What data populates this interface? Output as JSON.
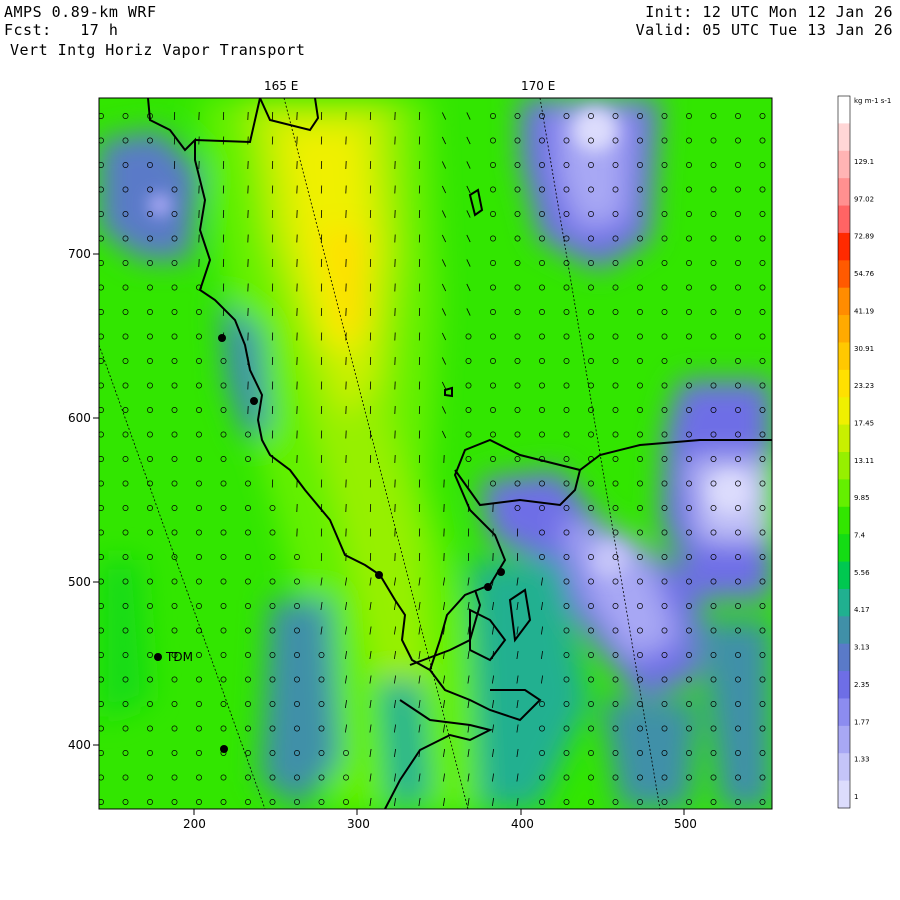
{
  "header": {
    "model": "AMPS 0.89-km WRF",
    "forecast": "Fcst:   17 h",
    "field": "Vert Intg Horiz Vapor Transport",
    "init": "Init: 12 UTC Mon 12 Jan 26",
    "valid": "Valid: 05 UTC Tue 13 Jan 26"
  },
  "map": {
    "longitude_labels": [
      "165 E",
      "170 E"
    ],
    "x_ticks": [
      "200",
      "300",
      "400",
      "500"
    ],
    "y_ticks": [
      "700",
      "600",
      "500",
      "400"
    ],
    "station_label": "TDM"
  },
  "colorbar": {
    "units": "kg m-1 s-1",
    "levels": [
      "129.1",
      "97.02",
      "72.89",
      "54.76",
      "41.19",
      "30.91",
      "23.23",
      "17.45",
      "13.11",
      "9.85",
      "7.4",
      "5.56",
      "4.17",
      "3.13",
      "2.35",
      "1.77",
      "1.33",
      "1"
    ],
    "colors": [
      "#ffffff",
      "#ffd6d6",
      "#ffb4b4",
      "#ff9090",
      "#ff6464",
      "#ff2a00",
      "#ff5a00",
      "#ff8c00",
      "#ffaa00",
      "#ffc800",
      "#ffe000",
      "#f0f000",
      "#c8f000",
      "#96f000",
      "#64f000",
      "#32e600",
      "#14dc14",
      "#00c850",
      "#20b090",
      "#4090a8",
      "#5a7ac8",
      "#6e6ee6",
      "#8c8cf0",
      "#a8a8f4",
      "#c4c4f8",
      "#dcdcfc"
    ]
  }
}
